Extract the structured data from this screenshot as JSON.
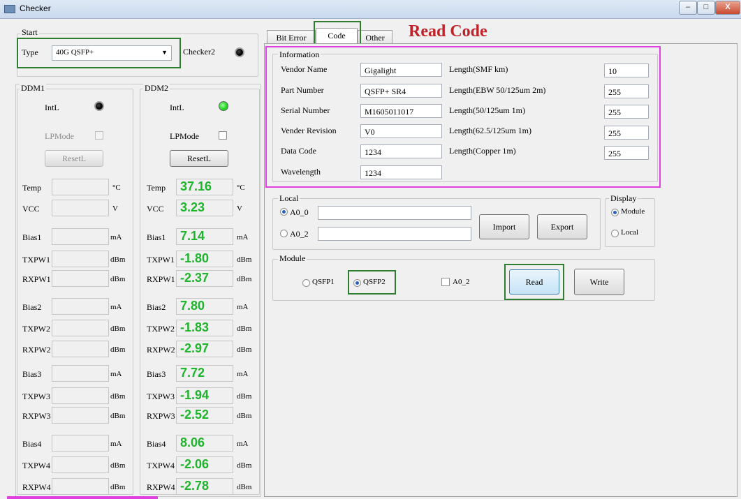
{
  "window": {
    "title": "Checker",
    "min": "–",
    "max": "□",
    "close": "X"
  },
  "annotation": {
    "heading": "Read Code"
  },
  "start": {
    "group_title": "Start",
    "type_label": "Type",
    "type_value": "40G QSFP+",
    "checker2_label": "Checker2"
  },
  "ddm1": {
    "group_title": "DDM1",
    "intl_label": "IntL",
    "lpmode_label": "LPMode",
    "reset_label": "ResetL"
  },
  "ddm2": {
    "group_title": "DDM2",
    "intl_label": "IntL",
    "lpmode_label": "LPMode",
    "reset_label": "ResetL"
  },
  "rows": [
    {
      "label": "Temp",
      "unit": "°C",
      "d2": "37.16"
    },
    {
      "label": "VCC",
      "unit": "V",
      "d2": "3.23"
    },
    {
      "label": "Bias1",
      "unit": "mA",
      "d2": "7.14"
    },
    {
      "label": "TXPW1",
      "unit": "dBm",
      "d2": "-1.80"
    },
    {
      "label": "RXPW1",
      "unit": "dBm",
      "d2": "-2.37"
    },
    {
      "label": "Bias2",
      "unit": "mA",
      "d2": "7.80"
    },
    {
      "label": "TXPW2",
      "unit": "dBm",
      "d2": "-1.83"
    },
    {
      "label": "RXPW2",
      "unit": "dBm",
      "d2": "-2.97"
    },
    {
      "label": "Bias3",
      "unit": "mA",
      "d2": "7.72"
    },
    {
      "label": "TXPW3",
      "unit": "dBm",
      "d2": "-1.94"
    },
    {
      "label": "RXPW3",
      "unit": "dBm",
      "d2": "-2.52"
    },
    {
      "label": "Bias4",
      "unit": "mA",
      "d2": "8.06"
    },
    {
      "label": "TXPW4",
      "unit": "dBm",
      "d2": "-2.06"
    },
    {
      "label": "RXPW4",
      "unit": "dBm",
      "d2": "-2.78"
    }
  ],
  "tabs": [
    {
      "label": "Bit Error"
    },
    {
      "label": "Code"
    },
    {
      "label": "Other"
    }
  ],
  "information": {
    "group_title": "Information",
    "left": [
      {
        "label": "Vendor Name",
        "value": "Gigalight"
      },
      {
        "label": "Part Number",
        "value": "QSFP+ SR4"
      },
      {
        "label": "Serial Number",
        "value": "M1605011017"
      },
      {
        "label": "Vender Revision",
        "value": "V0"
      },
      {
        "label": "Data Code",
        "value": "1234"
      },
      {
        "label": "Wavelength",
        "value": "1234"
      }
    ],
    "right": [
      {
        "label": "Length(SMF km)",
        "value": "10"
      },
      {
        "label": "Length(EBW 50/125um 2m)",
        "value": "255"
      },
      {
        "label": "Length(50/125um 1m)",
        "value": "255"
      },
      {
        "label": "Length(62.5/125um 1m)",
        "value": "255"
      },
      {
        "label": "Length(Copper 1m)",
        "value": "255"
      }
    ]
  },
  "local": {
    "group_title": "Local",
    "a0_0_label": "A0_0",
    "a0_2_label": "A0_2",
    "import_label": "Import",
    "export_label": "Export"
  },
  "display": {
    "group_title": "Display",
    "module_label": "Module",
    "local_label": "Local"
  },
  "module": {
    "group_title": "Module",
    "qsfp1_label": "QSFP1",
    "qsfp2_label": "QSFP2",
    "a0_2_label": "A0_2",
    "read_label": "Read",
    "write_label": "Write"
  }
}
